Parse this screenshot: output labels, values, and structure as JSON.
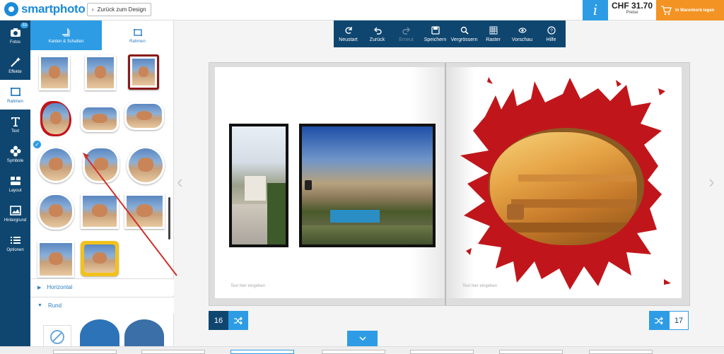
{
  "header": {
    "logo_text": "smartphoto",
    "back_label": "Zurück zum Design",
    "info_label": "i",
    "price": "CHF 31.70",
    "price_label": "Preise",
    "cart_label": "In Warenkorb legen"
  },
  "sidebar": {
    "items": [
      {
        "label": "Fotos",
        "icon": "camera-icon",
        "badge": "53"
      },
      {
        "label": "Effekte",
        "icon": "magic-wand-icon"
      },
      {
        "label": "Rahmen",
        "icon": "frame-icon"
      },
      {
        "label": "Text",
        "icon": "text-icon"
      },
      {
        "label": "Symbole",
        "icon": "flower-icon"
      },
      {
        "label": "Layout",
        "icon": "layout-icon"
      },
      {
        "label": "Hintergrund",
        "icon": "image-icon"
      },
      {
        "label": "Optionen",
        "icon": "list-icon"
      }
    ]
  },
  "panel": {
    "tabs": [
      {
        "label": "Kanten & Schatten"
      },
      {
        "label": "Rahmen"
      }
    ],
    "sections": [
      {
        "label": "Horizontal"
      },
      {
        "label": "Rund"
      }
    ]
  },
  "toolbar": {
    "items": [
      {
        "label": "Neustart",
        "icon": "refresh-icon"
      },
      {
        "label": "Zurück",
        "icon": "undo-icon"
      },
      {
        "label": "Erneut",
        "icon": "redo-icon"
      },
      {
        "label": "Speichern",
        "icon": "save-icon"
      },
      {
        "label": "Vergrössern",
        "icon": "zoom-icon"
      },
      {
        "label": "Raster",
        "icon": "grid-icon"
      },
      {
        "label": "Vorschau",
        "icon": "eye-icon"
      },
      {
        "label": "Hilfe",
        "icon": "help-icon"
      }
    ]
  },
  "book": {
    "left_hint": "Text hier eingeben",
    "right_hint": "Text hier eingeben"
  },
  "pages": {
    "left": "16",
    "right": "17"
  },
  "colors": {
    "navy": "#0f4670",
    "blue": "#2d9ce5",
    "orange": "#f39323",
    "splash_red": "#c0161b"
  }
}
